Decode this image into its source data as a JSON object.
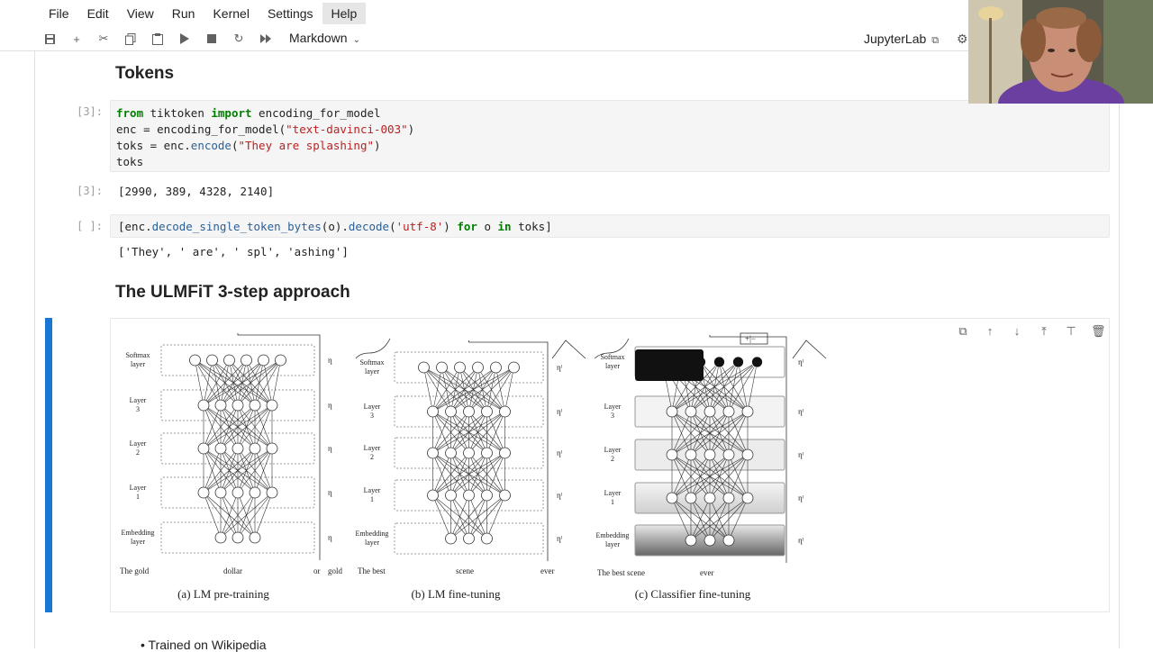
{
  "menu": [
    "File",
    "Edit",
    "View",
    "Run",
    "Kernel",
    "Settings",
    "Help"
  ],
  "toolbar": {
    "cell_type": "Markdown",
    "jupyterlab_label": "JupyterLab",
    "icons": [
      "save-icon",
      "add-icon",
      "cut-icon",
      "copy-icon",
      "paste-icon",
      "run-icon",
      "stop-icon",
      "restart-icon",
      "fast-forward-icon"
    ]
  },
  "notebook": {
    "heading_tokens": "Tokens",
    "cell1": {
      "prompt": "[3]:",
      "out_prompt": "[3]:",
      "output": "[2990, 389, 4328, 2140]"
    },
    "cell2": {
      "prompt": "[ ]:",
      "output": "['They', ' are', ' spl', 'ashing']"
    },
    "heading_ulmfit": "The ULMFiT 3-step approach",
    "bullet": "Trained on Wikipedia"
  },
  "figure": {
    "captions": [
      "(a) LM pre-training",
      "(b) LM fine-tuning",
      "(c) Classifier fine-tuning"
    ],
    "layer_labels_a": [
      "Softmax layer",
      "Layer 3",
      "Layer 2",
      "Layer 1",
      "Embedding layer"
    ],
    "bottom_words_a": [
      "The gold",
      "dollar",
      "or",
      "gold"
    ],
    "bottom_words_b": [
      "The best",
      "scene",
      "ever"
    ],
    "bottom_words_c": [
      "The best scene",
      "ever"
    ],
    "eta": "η",
    "eta_l": "ηˡ",
    "plus_minus": "+|−"
  }
}
